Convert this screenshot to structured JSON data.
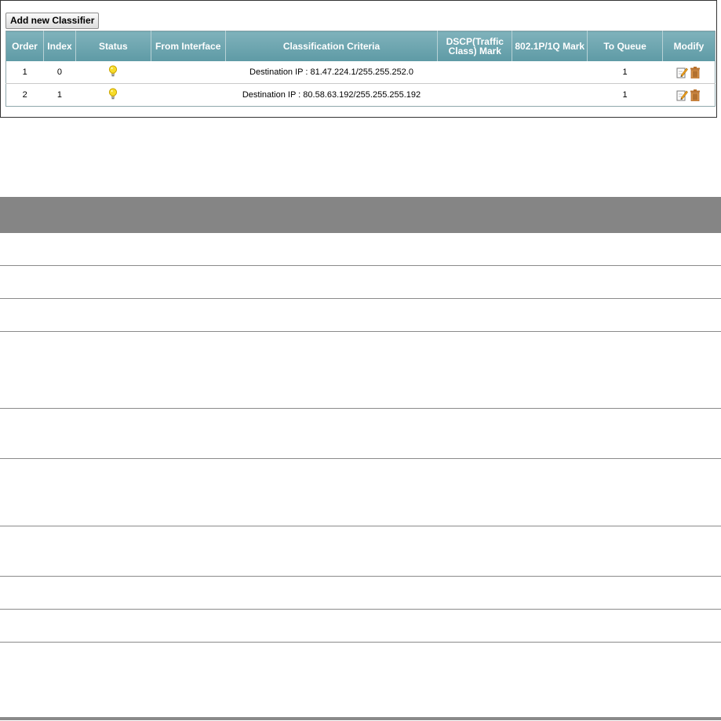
{
  "toolbar": {
    "add_label": "Add new Classifier"
  },
  "table": {
    "headers": [
      "Order",
      "Index",
      "Status",
      "From Interface",
      "Classification Criteria",
      "DSCP(Traffic Class) Mark",
      "802.1P/1Q Mark",
      "To Queue",
      "Modify"
    ],
    "rows": [
      {
        "order": "1",
        "index": "0",
        "status": "active",
        "from_interface": "",
        "criteria": "Destination IP : 81.47.224.1/255.255.252.0",
        "dscp": "",
        "mark_8021p": "",
        "queue": "1"
      },
      {
        "order": "2",
        "index": "1",
        "status": "active",
        "from_interface": "",
        "criteria": "Destination IP : 80.58.63.192/255.255.255.192",
        "dscp": "",
        "mark_8021p": "",
        "queue": "1"
      }
    ]
  },
  "colors": {
    "header_bg": "#6aa5ae",
    "status_bulb": "#f5d41a",
    "doc_header_bg": "#858585"
  },
  "icons": {
    "status": "lightbulb-icon",
    "edit": "edit-icon",
    "delete": "trash-icon"
  }
}
